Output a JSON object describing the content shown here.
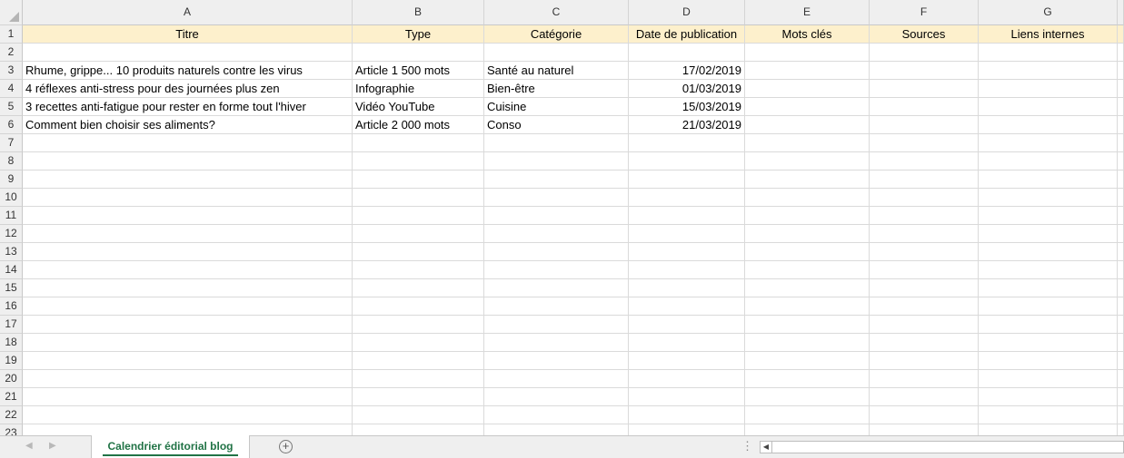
{
  "columns": [
    "A",
    "B",
    "C",
    "D",
    "E",
    "F",
    "G"
  ],
  "row_numbers": [
    "1",
    "2",
    "3",
    "4",
    "5",
    "6",
    "7",
    "8",
    "9",
    "10",
    "11",
    "12",
    "13",
    "14",
    "15",
    "16",
    "17",
    "18",
    "19",
    "20",
    "21",
    "22",
    "23"
  ],
  "header": [
    "Titre",
    "Type",
    "Catégorie",
    "Date de publication",
    "Mots clés",
    "Sources",
    "Liens internes"
  ],
  "rows": [
    [
      "Rhume, grippe... 10 produits naturels contre les virus",
      "Article 1 500 mots",
      "Santé au naturel",
      "17/02/2019",
      "",
      "",
      ""
    ],
    [
      "4 réflexes anti-stress pour des journées plus zen",
      "Infographie",
      "Bien-être",
      "01/03/2019",
      "",
      "",
      ""
    ],
    [
      "3 recettes anti-fatigue pour rester en forme tout l'hiver",
      "Vidéo YouTube",
      "Cuisine",
      "15/03/2019",
      "",
      "",
      ""
    ],
    [
      "Comment bien choisir ses aliments?",
      "Article 2 000 mots",
      "Conso",
      "21/03/2019",
      "",
      "",
      ""
    ]
  ],
  "header_fill": "#fdf0cc",
  "accent": "#217346",
  "sheet_tab": "Calendrier éditorial blog",
  "icons": {
    "add_sheet": "plus-circle",
    "nav_prev": "triangle-left",
    "nav_next": "triangle-right",
    "scroll_left": "arrow-left"
  }
}
